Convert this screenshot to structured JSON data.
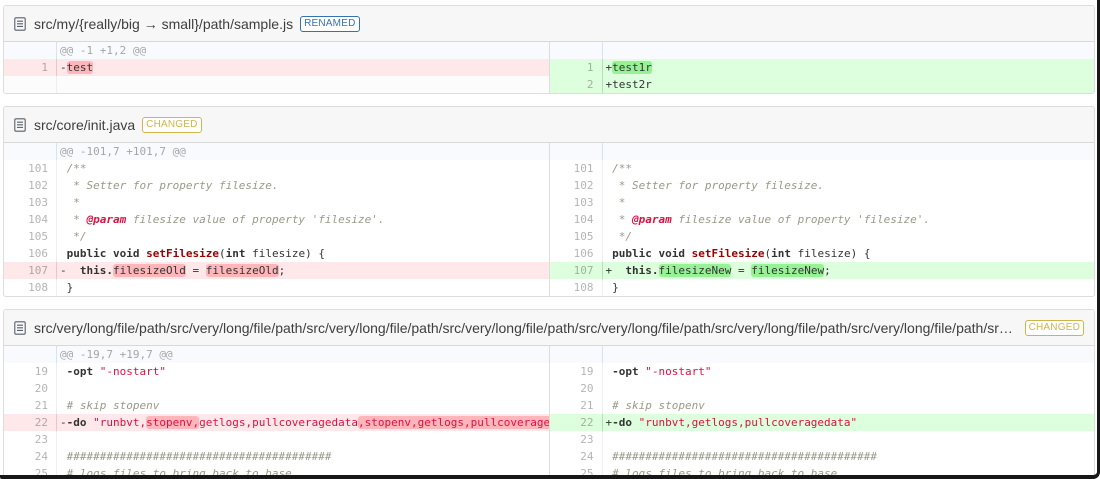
{
  "colors": {
    "renamed_badge": "#3572b0",
    "changed_badge": "#d0b44c",
    "del_line_bg": "#fee8e9",
    "del_word_bg": "#ffb6ba",
    "ins_line_bg": "#ddffdd",
    "ins_word_bg": "#97f295",
    "hunk_bg": "#f8fafd"
  },
  "files": [
    {
      "name": "src/my/{really/big → small}/path/sample.js",
      "tag": {
        "label": "RENAMED",
        "color": "#3572b0"
      },
      "left": [
        {
          "t": "info",
          "s": [
            [
              "",
              "@@ -1 +1,2 @@"
            ]
          ]
        },
        {
          "t": "del",
          "n": "1",
          "p": "-",
          "s": [
            [
              "hd",
              "test"
            ]
          ]
        },
        {
          "t": "empty",
          "s": []
        }
      ],
      "right": [
        {
          "t": "info",
          "s": []
        },
        {
          "t": "ins",
          "n": "1",
          "p": "+",
          "s": [
            [
              "hi",
              "test1r"
            ]
          ]
        },
        {
          "t": "ins",
          "n": "2",
          "p": "+",
          "s": [
            [
              "",
              "test2r"
            ]
          ]
        }
      ]
    },
    {
      "name": "src/core/init.java",
      "tag": {
        "label": "CHANGED",
        "color": "#d0b44c"
      },
      "left": [
        {
          "t": "info",
          "s": [
            [
              "",
              "@@ -101,7 +101,7 @@"
            ]
          ]
        },
        {
          "t": "ctx",
          "n": "101",
          "p": " ",
          "s": [
            [
              "c",
              "/**"
            ]
          ]
        },
        {
          "t": "ctx",
          "n": "102",
          "p": " ",
          "s": [
            [
              "c",
              " * Setter for property filesize."
            ]
          ]
        },
        {
          "t": "ctx",
          "n": "103",
          "p": " ",
          "s": [
            [
              "c",
              " *"
            ]
          ]
        },
        {
          "t": "ctx",
          "n": "104",
          "p": " ",
          "s": [
            [
              "c",
              " * "
            ],
            [
              "d",
              "@param"
            ],
            [
              "c",
              " filesize value of property 'filesize'."
            ]
          ]
        },
        {
          "t": "ctx",
          "n": "105",
          "p": " ",
          "s": [
            [
              "c",
              " */"
            ]
          ]
        },
        {
          "t": "ctx",
          "n": "106",
          "p": " ",
          "s": [
            [
              "k",
              "public"
            ],
            [
              "",
              " "
            ],
            [
              "k",
              "void"
            ],
            [
              "",
              " "
            ],
            [
              "f",
              "setFilesize"
            ],
            [
              "",
              "("
            ],
            [
              "k",
              "int"
            ],
            [
              "",
              " filesize) {"
            ]
          ]
        },
        {
          "t": "del",
          "n": "107",
          "p": "-",
          "s": [
            [
              "",
              "  "
            ],
            [
              "k",
              "this."
            ],
            [
              "hd",
              "filesizeOld"
            ],
            [
              "",
              " = "
            ],
            [
              "hd",
              "filesizeOld"
            ],
            [
              "",
              ";"
            ]
          ]
        },
        {
          "t": "ctx",
          "n": "108",
          "p": " ",
          "s": [
            [
              "",
              "}"
            ]
          ]
        }
      ],
      "right": [
        {
          "t": "info",
          "s": []
        },
        {
          "t": "ctx",
          "n": "101",
          "p": " ",
          "s": [
            [
              "c",
              "/**"
            ]
          ]
        },
        {
          "t": "ctx",
          "n": "102",
          "p": " ",
          "s": [
            [
              "c",
              " * Setter for property filesize."
            ]
          ]
        },
        {
          "t": "ctx",
          "n": "103",
          "p": " ",
          "s": [
            [
              "c",
              " *"
            ]
          ]
        },
        {
          "t": "ctx",
          "n": "104",
          "p": " ",
          "s": [
            [
              "c",
              " * "
            ],
            [
              "d",
              "@param"
            ],
            [
              "c",
              " filesize value of property 'filesize'."
            ]
          ]
        },
        {
          "t": "ctx",
          "n": "105",
          "p": " ",
          "s": [
            [
              "c",
              " */"
            ]
          ]
        },
        {
          "t": "ctx",
          "n": "106",
          "p": " ",
          "s": [
            [
              "k",
              "public"
            ],
            [
              "",
              " "
            ],
            [
              "k",
              "void"
            ],
            [
              "",
              " "
            ],
            [
              "f",
              "setFilesize"
            ],
            [
              "",
              "("
            ],
            [
              "k",
              "int"
            ],
            [
              "",
              " filesize) {"
            ]
          ]
        },
        {
          "t": "ins",
          "n": "107",
          "p": "+",
          "s": [
            [
              "",
              "  "
            ],
            [
              "k",
              "this."
            ],
            [
              "hi",
              "filesizeNew"
            ],
            [
              "",
              " = "
            ],
            [
              "hi",
              "filesizeNew"
            ],
            [
              "",
              ";"
            ]
          ]
        },
        {
          "t": "ctx",
          "n": "108",
          "p": " ",
          "s": [
            [
              "",
              "}"
            ]
          ]
        }
      ]
    },
    {
      "name": "src/very/long/file/path/src/very/long/file/path/src/very/long/file/path/src/very/long/file/path/src/very/long/file/path/src/very/long/file/path/src/very/long/file/path/src/very/long/file/path/src/very/long/file/path",
      "tag": {
        "label": "CHANGED",
        "color": "#d0b44c"
      },
      "left": [
        {
          "t": "info",
          "s": [
            [
              "",
              "@@ -19,7 +19,7 @@"
            ]
          ]
        },
        {
          "t": "ctx",
          "n": "19",
          "p": " ",
          "s": [
            [
              "k",
              "-opt"
            ],
            [
              "",
              " "
            ],
            [
              "s",
              "\"-nostart\""
            ]
          ]
        },
        {
          "t": "ctx",
          "n": "20",
          "p": " ",
          "s": []
        },
        {
          "t": "ctx",
          "n": "21",
          "p": " ",
          "s": [
            [
              "c",
              "# skip stopenv"
            ]
          ]
        },
        {
          "t": "del",
          "n": "22",
          "p": "-",
          "s": [
            [
              "k",
              "-do"
            ],
            [
              "",
              " "
            ],
            [
              "s",
              "\"runbvt,"
            ],
            [
              "s hd",
              "stopenv,"
            ],
            [
              "s",
              "getlogs,pullcoveragedata"
            ],
            [
              "s hd",
              ",stopenv,getlogs,pullcoveragedata"
            ],
            [
              "s",
              "\""
            ]
          ]
        },
        {
          "t": "ctx",
          "n": "23",
          "p": " ",
          "s": []
        },
        {
          "t": "ctx",
          "n": "24",
          "p": " ",
          "s": [
            [
              "c",
              "########################################"
            ]
          ]
        },
        {
          "t": "ctx",
          "n": "25",
          "p": " ",
          "s": [
            [
              "c",
              "# logs files to bring back to base"
            ]
          ]
        }
      ],
      "right": [
        {
          "t": "info",
          "s": []
        },
        {
          "t": "ctx",
          "n": "19",
          "p": " ",
          "s": [
            [
              "k",
              "-opt"
            ],
            [
              "",
              " "
            ],
            [
              "s",
              "\"-nostart\""
            ]
          ]
        },
        {
          "t": "ctx",
          "n": "20",
          "p": " ",
          "s": []
        },
        {
          "t": "ctx",
          "n": "21",
          "p": " ",
          "s": [
            [
              "c",
              "# skip stopenv"
            ]
          ]
        },
        {
          "t": "ins",
          "n": "22",
          "p": "+",
          "s": [
            [
              "k",
              "-do"
            ],
            [
              "",
              " "
            ],
            [
              "s",
              "\"runbvt,getlogs,pullcoveragedata\""
            ]
          ]
        },
        {
          "t": "ctx",
          "n": "23",
          "p": " ",
          "s": []
        },
        {
          "t": "ctx",
          "n": "24",
          "p": " ",
          "s": [
            [
              "c",
              "########################################"
            ]
          ]
        },
        {
          "t": "ctx",
          "n": "25",
          "p": " ",
          "s": [
            [
              "c",
              "# logs files to bring back to base"
            ]
          ]
        }
      ]
    }
  ]
}
